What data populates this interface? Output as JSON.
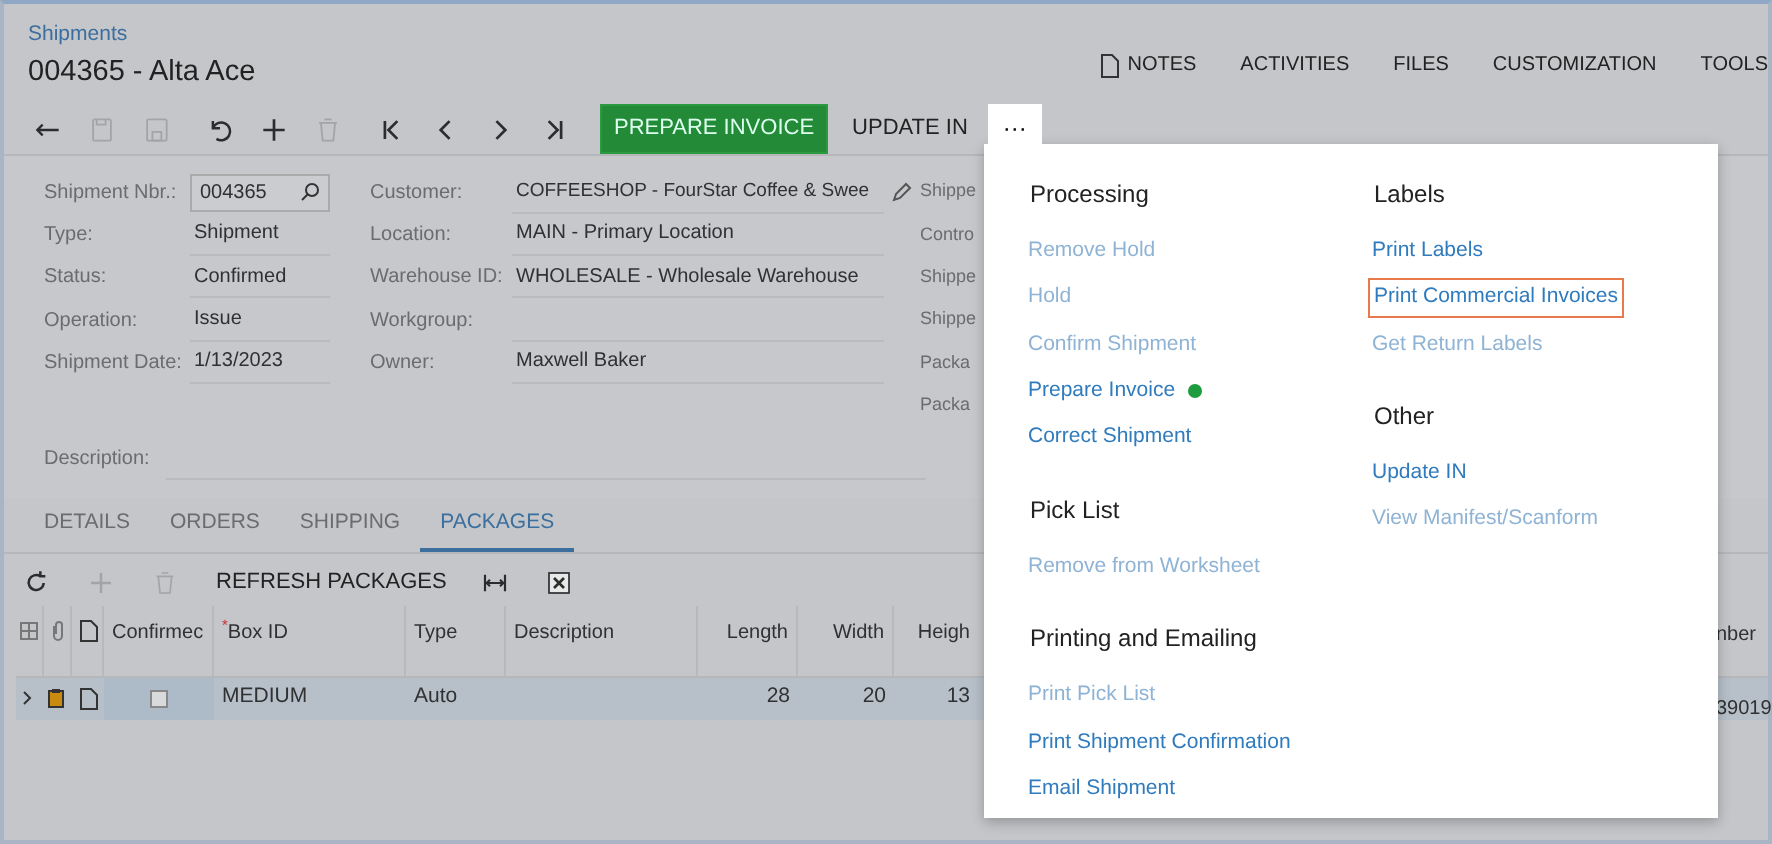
{
  "breadcrumb": "Shipments",
  "title": "004365 - Alta Ace",
  "top_links": [
    {
      "label": "NOTES",
      "kind": "notes"
    },
    {
      "label": "ACTIVITIES"
    },
    {
      "label": "FILES"
    },
    {
      "label": "CUSTOMIZATION"
    },
    {
      "label": "TOOLS"
    }
  ],
  "toolbar": [
    {
      "kind": "back",
      "disabled": false
    },
    {
      "kind": "save-close",
      "disabled": true
    },
    {
      "kind": "save",
      "disabled": true
    },
    {
      "kind": "undo",
      "disabled": false
    },
    {
      "kind": "add",
      "disabled": false
    },
    {
      "kind": "delete",
      "disabled": true
    },
    {
      "kind": "first",
      "disabled": false
    },
    {
      "kind": "prev",
      "disabled": false
    },
    {
      "kind": "next",
      "disabled": false
    },
    {
      "kind": "last",
      "disabled": false
    }
  ],
  "primary_action": "PREPARE INVOICE",
  "secondary_action": "UPDATE IN",
  "more_button": "···",
  "form_columns": [
    [
      {
        "label": "Shipment Nbr.:",
        "value": "004365",
        "kind": "lookup"
      },
      {
        "label": "Type:",
        "value": "Shipment"
      },
      {
        "label": "Status:",
        "value": "Confirmed"
      },
      {
        "label": "Operation:",
        "value": "Issue"
      },
      {
        "label": "Shipment Date:",
        "value": "1/13/2023"
      }
    ],
    [
      {
        "label": "Customer:",
        "value": "COFFEESHOP - FourStar Coffee & Swee",
        "kind": "edit"
      },
      {
        "label": "Location:",
        "value": "MAIN - Primary Location"
      },
      {
        "label": "Warehouse ID:",
        "value": "WHOLESALE - Wholesale Warehouse"
      },
      {
        "label": "Workgroup:",
        "kind": "blank"
      },
      {
        "label": "Owner:",
        "value": "Maxwell Baker"
      }
    ],
    [
      {
        "label": "Shippe"
      },
      {
        "label": "Contro"
      },
      {
        "label": "Shippe"
      },
      {
        "label": "Shippe"
      },
      {
        "label": "Packa"
      },
      {
        "label": "Packa"
      }
    ]
  ],
  "description_label": "Description:",
  "tabs": [
    {
      "label": "DETAILS",
      "selected": false
    },
    {
      "label": "ORDERS",
      "selected": false
    },
    {
      "label": "SHIPPING",
      "selected": false
    },
    {
      "label": "PACKAGES",
      "selected": true
    }
  ],
  "grid_toolbar": [
    {
      "kind": "refresh",
      "disabled": false
    },
    {
      "kind": "add",
      "disabled": true
    },
    {
      "kind": "delete",
      "disabled": true
    },
    {
      "kind": "text",
      "label": "REFRESH PACKAGES"
    },
    {
      "kind": "fit",
      "disabled": false
    },
    {
      "kind": "excel",
      "disabled": false
    }
  ],
  "table": {
    "columns": [
      {
        "label": "Confirmec",
        "kind": "check"
      },
      {
        "label": "Box ID",
        "required_mark": "*"
      },
      {
        "label": "Type"
      },
      {
        "label": "Description"
      },
      {
        "label": "Length",
        "kind": "number"
      },
      {
        "label": "Width",
        "kind": "number"
      },
      {
        "label": "Heigh",
        "kind": "number"
      }
    ],
    "rows": [
      {
        "selected": true,
        "confirmed": false,
        "cells": [
          "",
          "MEDIUM",
          "Auto",
          "",
          "28",
          "20",
          "13"
        ]
      }
    ],
    "right_column_label": "nber",
    "right_column_value": "39019"
  },
  "menu": [
    [
      {
        "title": "Processing",
        "items": [
          {
            "label": "Remove Hold",
            "disabled": true
          },
          {
            "label": "Hold",
            "disabled": true
          },
          {
            "label": "Confirm Shipment",
            "disabled": true
          },
          {
            "label": "Prepare Invoice",
            "disabled": false,
            "color": "#1e9b3c"
          },
          {
            "label": "Correct Shipment",
            "disabled": false
          }
        ]
      },
      {
        "title": "Pick List",
        "items": [
          {
            "label": "Remove from Worksheet",
            "disabled": true
          }
        ]
      },
      {
        "title": "Printing and Emailing",
        "items": [
          {
            "label": "Print Pick List",
            "disabled": true
          },
          {
            "label": "Print Shipment Confirmation",
            "disabled": false
          },
          {
            "label": "Email Shipment",
            "disabled": false
          }
        ]
      }
    ],
    [
      {
        "title": "Labels",
        "items": [
          {
            "label": "Print Labels",
            "disabled": false
          },
          {
            "label": "Print Commercial Invoices",
            "disabled": false,
            "highlighted": true
          },
          {
            "label": "Get Return Labels",
            "disabled": true
          }
        ]
      },
      {
        "title": "Other",
        "items": [
          {
            "label": "Update IN",
            "disabled": false
          },
          {
            "label": "View Manifest/Scanform",
            "disabled": true
          }
        ]
      }
    ]
  ]
}
